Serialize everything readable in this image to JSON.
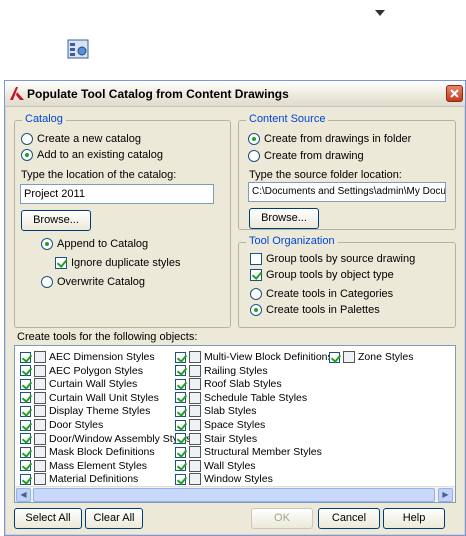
{
  "dialog": {
    "title": "Populate Tool Catalog from Content Drawings"
  },
  "catalog": {
    "group_title": "Catalog",
    "create_new_label": "Create a new catalog",
    "add_existing_label": "Add to an existing catalog",
    "location_label": "Type the location of the catalog:",
    "location_value": "Project 2011",
    "browse_label": "Browse...",
    "append_label": "Append to Catalog",
    "ignore_duplicates_label": "Ignore duplicate styles",
    "overwrite_label": "Overwrite Catalog"
  },
  "content_source": {
    "group_title": "Content Source",
    "from_folder_label": "Create from drawings in folder",
    "from_drawing_label": "Create from drawing",
    "source_label": "Type the source folder location:",
    "source_value": "C:\\Documents and Settings\\admin\\My Document:",
    "browse_label": "Browse..."
  },
  "tool_org": {
    "group_title": "Tool Organization",
    "group_by_drawing_label": "Group tools by source drawing",
    "group_by_type_label": "Group tools by object type",
    "in_categories_label": "Create tools in Categories",
    "in_palettes_label": "Create tools in Palettes"
  },
  "objects": {
    "heading": "Create tools for the following objects:",
    "col1": [
      "AEC Dimension Styles",
      "AEC Polygon Styles",
      "Curtain Wall Styles",
      "Curtain Wall Unit Styles",
      "Display Theme Styles",
      "Door Styles",
      "Door/Window Assembly Styles",
      "Mask Block Definitions",
      "Mass Element Styles",
      "Material Definitions"
    ],
    "col2": [
      "Multi-View Block Definitions",
      "Railing Styles",
      "Roof Slab Styles",
      "Schedule Table Styles",
      "Slab Styles",
      "Space Styles",
      "Stair Styles",
      "Structural Member Styles",
      "Wall Styles",
      "Window Styles"
    ],
    "col3": [
      "Zone Styles"
    ]
  },
  "buttons": {
    "select_all": "Select All",
    "clear_all": "Clear All",
    "ok": "OK",
    "cancel": "Cancel",
    "help": "Help"
  },
  "icons": {
    "top_dropdown": "dropdown-arrow-icon",
    "top_tool": "tool-catalog-icon",
    "app_logo": "autocad-logo-icon",
    "close": "close-icon"
  }
}
